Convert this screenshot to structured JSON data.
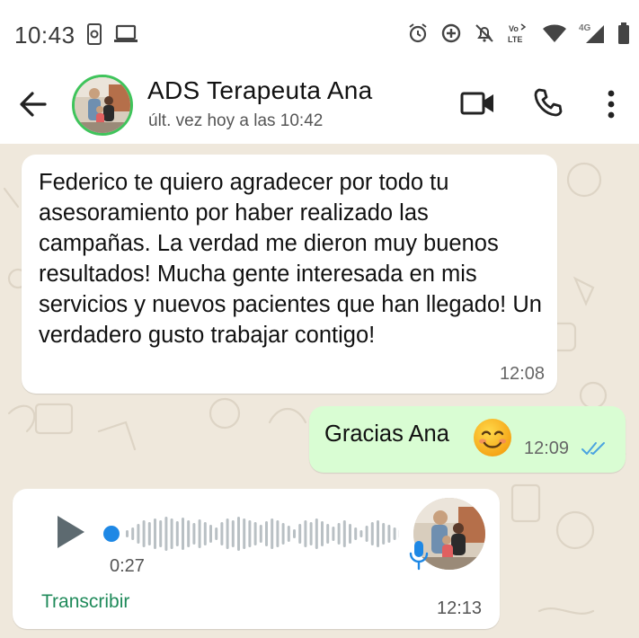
{
  "status_bar": {
    "time": "10:43",
    "network_label": "4G",
    "volte_label": "Vo LTE"
  },
  "header": {
    "contact_name": "ADS Terapeuta Ana",
    "last_seen": "últ. vez hoy a las 10:42"
  },
  "messages": [
    {
      "direction": "incoming",
      "text": "Federico te quiero agradecer por todo tu asesoramiento por haber realizado las campañas. La verdad me dieron muy buenos resultados! Mucha gente interesada en mis servicios y nuevos pacientes que han llegado! Un verdadero gusto trabajar contigo!",
      "time": "12:08"
    },
    {
      "direction": "outgoing",
      "text": "Gracias Ana",
      "emoji": "smiling-face-emoji",
      "time": "12:09",
      "status": "read"
    },
    {
      "direction": "incoming",
      "type": "voice",
      "duration": "0:27",
      "transcribe_label": "Transcribir",
      "time": "12:13"
    }
  ],
  "colors": {
    "chat_background": "#efe8dc",
    "incoming_bubble": "#ffffff",
    "outgoing_bubble": "#d9fdd3",
    "accent_green": "#1f8a5a",
    "read_ticks": "#4aa3e0",
    "voice_progress_dot": "#1e88e5"
  }
}
